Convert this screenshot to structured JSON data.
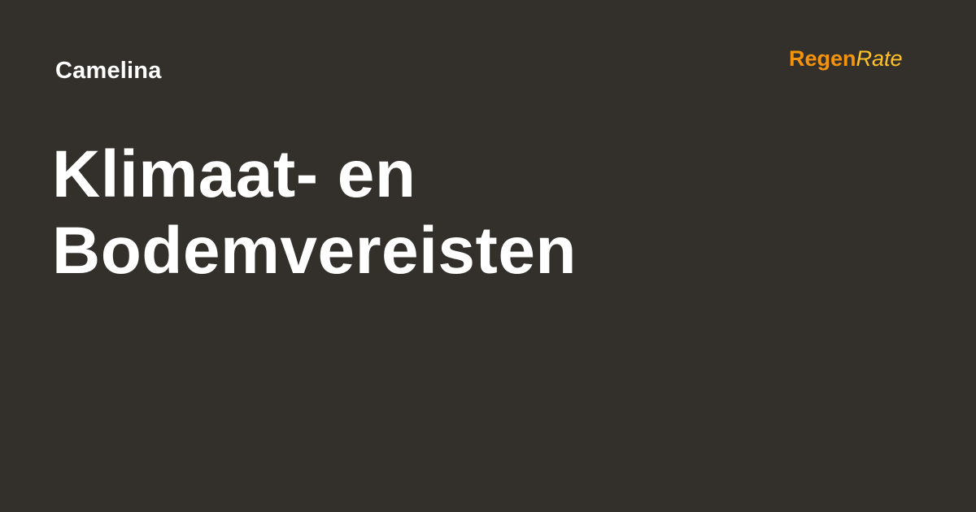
{
  "category": "Camelina",
  "headline": {
    "line1": "Klimaat- en",
    "line2": "Bodemvereisten"
  },
  "brand": {
    "part1": "Regen",
    "part2": "Rate"
  },
  "colors": {
    "background": "#33302b",
    "text": "#ffffff",
    "brand_primary": "#f3930b",
    "brand_secondary": "#ffc227"
  }
}
